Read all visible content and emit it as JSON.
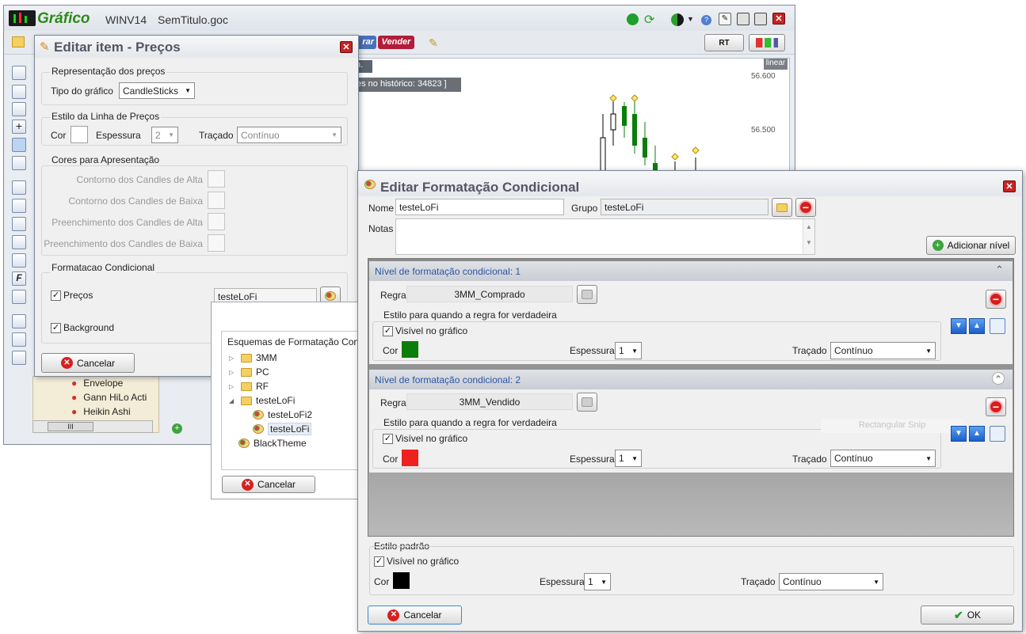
{
  "main_window": {
    "app_name": "Gráfico",
    "asset": "WINV14",
    "file": "SemTitulo.goc"
  },
  "toolbar": {
    "buy_partial": "rar",
    "sell": "Vender",
    "rt_label": "RT"
  },
  "chart": {
    "scale": "linear",
    "prices": [
      "56.600",
      "56.500"
    ],
    "history_text": "es no histórico: 34823 ]",
    "tab_text": "n."
  },
  "indicators": [
    "Envelope",
    "Gann HiLo Acti",
    "Heikin Ashi"
  ],
  "scroll_label": "III",
  "edit_item": {
    "title": "Editar item - Preços",
    "rep_group": "Representação dos preços",
    "chart_type_label": "Tipo do gráfico",
    "chart_type_value": "CandleSticks",
    "line_group": "Estilo da Linha de Preços",
    "cor": "Cor",
    "espessura": "Espessura",
    "espessura_value": "2",
    "tracado": "Traçado",
    "tracado_value": "Contínuo",
    "colors_group": "Cores para Apresentação",
    "color_rows": [
      "Contorno dos Candles de Alta",
      "Contorno dos Candles de Baixa",
      "Preenchimento dos Candles de Alta",
      "Preenchimento dos Candles de Baixa"
    ],
    "cond_group": "Formatacao Condicional",
    "precos": "Preços",
    "precos_value": "testeLoFi",
    "background": "Background",
    "cancel": "Cancelar"
  },
  "schemes": {
    "title": "Esquemas de Formatação Cond",
    "items": [
      {
        "label": "3MM",
        "type": "folder",
        "expand": "▷"
      },
      {
        "label": "PC",
        "type": "folder",
        "expand": "▷"
      },
      {
        "label": "RF",
        "type": "folder",
        "expand": "▷"
      },
      {
        "label": "testeLoFi",
        "type": "folder",
        "expand": "◢"
      }
    ],
    "children": [
      "testeLoFi2",
      "testeLoFi"
    ],
    "extra": "BlackTheme",
    "cancel": "Cancelar"
  },
  "cond_format": {
    "title": "Editar Formatação Condicional",
    "nome_label": "Nome",
    "nome_value": "testeLoFi",
    "grupo_label": "Grupo",
    "grupo_value": "testeLoFi",
    "notas_label": "Notas",
    "add_level": "Adicionar nível",
    "levels": [
      {
        "header": "Nível de formatação condicional: 1",
        "regra_label": "Regra",
        "regra_value": "3MM_Comprado",
        "style_title": "Estilo para quando a regra for verdadeira",
        "visible": "Visível no gráfico",
        "cor": "Cor",
        "color": "#0a7d0a",
        "espessura": "Espessura",
        "espessura_value": "1",
        "tracado": "Traçado",
        "tracado_value": "Contínuo",
        "toggle": "⌃"
      },
      {
        "header": "Nível de formatação condicional: 2",
        "regra_label": "Regra",
        "regra_value": "3MM_Vendido",
        "style_title": "Estilo para quando a regra for verdadeira",
        "visible": "Visível no gráfico",
        "cor": "Cor",
        "color": "#f02020",
        "espessura": "Espessura",
        "espessura_value": "1",
        "tracado": "Traçado",
        "tracado_value": "Contínuo",
        "toggle": "⌃"
      }
    ],
    "ghost_text": "Rectangular Snip",
    "default_style": {
      "title": "Estilo padrão",
      "visible": "Visível no gráfico",
      "cor": "Cor",
      "color": "#000000",
      "espessura": "Espessura",
      "espessura_value": "1",
      "tracado": "Traçado",
      "tracado_value": "Contínuo"
    },
    "cancel": "Cancelar",
    "ok": "OK"
  }
}
